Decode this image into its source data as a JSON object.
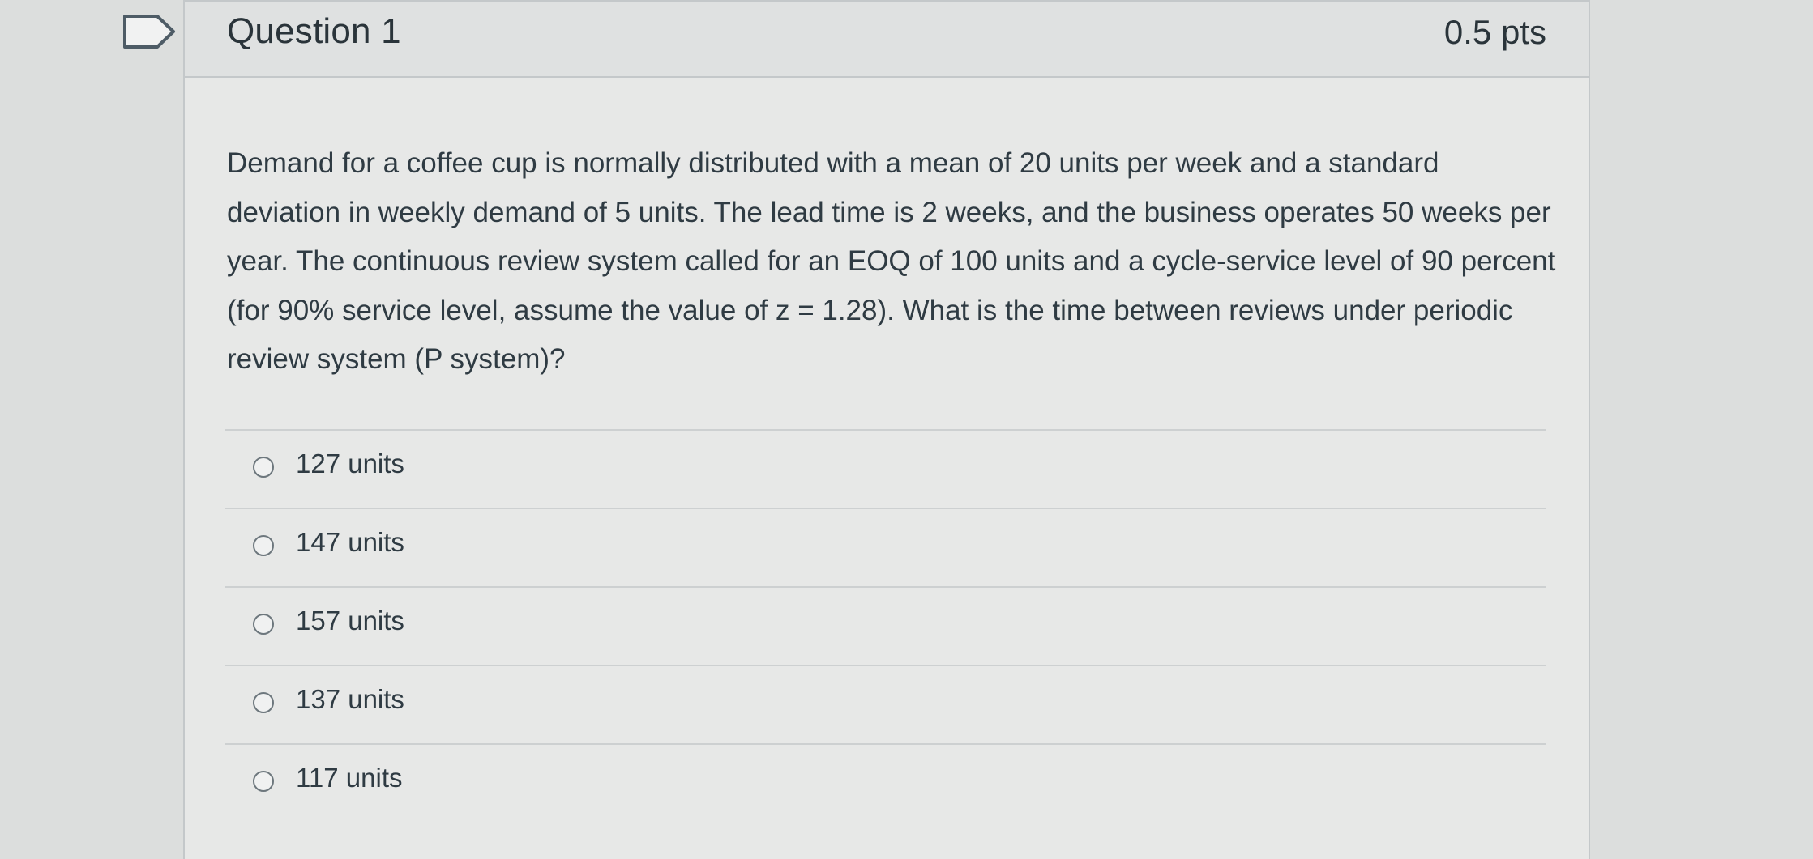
{
  "question": {
    "title": "Question 1",
    "points": "0.5 pts",
    "text": "Demand for a coffee cup is normally distributed with a mean of 20 units per week and a standard deviation in weekly demand of 5 units. The lead time is 2 weeks, and the business operates 50 weeks per year. The continuous review system called for an EOQ of 100 units and a cycle-service level of 90 percent (for 90% service level, assume the value of z = 1.28). What is the time between reviews under periodic review system (P system)?",
    "answers": [
      {
        "label": "127 units"
      },
      {
        "label": "147 units"
      },
      {
        "label": "157 units"
      },
      {
        "label": "137 units"
      },
      {
        "label": "117 units"
      }
    ]
  },
  "icons": {
    "flag": "flag-question-icon",
    "radio": "radio-button-icon"
  },
  "colors": {
    "background": "#dcdedd",
    "card": "#e7e8e7",
    "header": "#dfe1e1",
    "text": "#2d3b45",
    "border": "#c4c8ca"
  }
}
